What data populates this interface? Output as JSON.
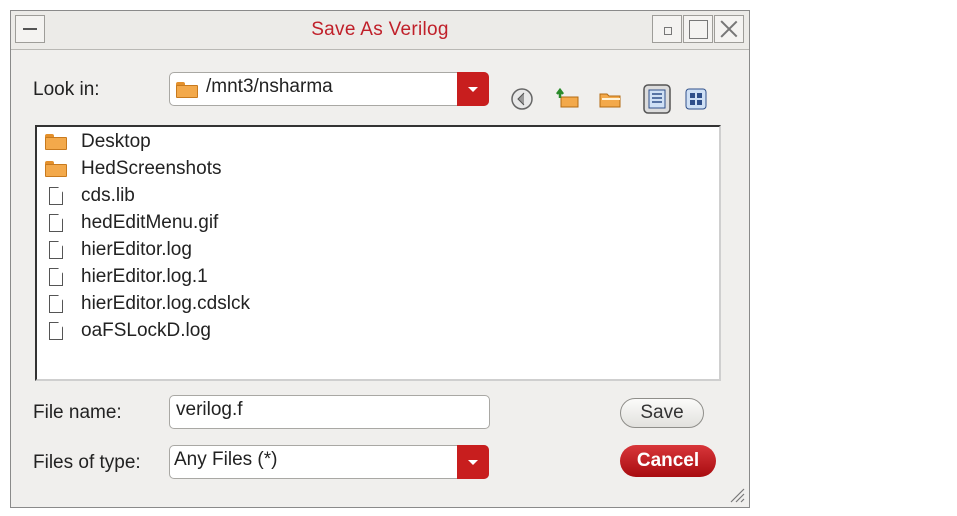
{
  "window": {
    "title": "Save As Verilog"
  },
  "look_in": {
    "label": "Look in:",
    "value": "/mnt3/nsharma"
  },
  "toolbar": {
    "icons": [
      "back-icon",
      "up-folder-icon",
      "new-folder-icon",
      "list-view-icon",
      "details-view-icon"
    ]
  },
  "files": [
    {
      "name": "Desktop",
      "type": "folder"
    },
    {
      "name": "HedScreenshots",
      "type": "folder"
    },
    {
      "name": "cds.lib",
      "type": "file"
    },
    {
      "name": "hedEditMenu.gif",
      "type": "file"
    },
    {
      "name": "hierEditor.log",
      "type": "file"
    },
    {
      "name": "hierEditor.log.1",
      "type": "file"
    },
    {
      "name": "hierEditor.log.cdslck",
      "type": "file"
    },
    {
      "name": "oaFSLockD.log",
      "type": "file"
    }
  ],
  "file_name": {
    "label": "File name:",
    "value": "verilog.f"
  },
  "file_type": {
    "label": "Files of type:",
    "value": "Any Files (*)"
  },
  "buttons": {
    "save": "Save",
    "cancel": "Cancel"
  },
  "colors": {
    "title": "#c0202a",
    "accent": "#c81e1e"
  }
}
